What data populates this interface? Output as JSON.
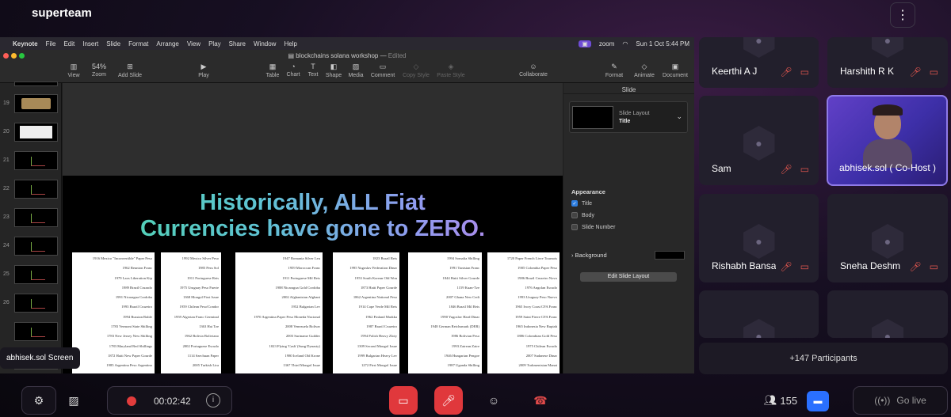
{
  "app": {
    "brand": "superteam",
    "menu_icon": "kebab-icon"
  },
  "mac_menubar": {
    "app_name": "Keynote",
    "items": [
      "File",
      "Edit",
      "Insert",
      "Slide",
      "Format",
      "Arrange",
      "View",
      "Play",
      "Share",
      "Window",
      "Help"
    ],
    "zoom": "zoom",
    "datetime": "Sun 1 Oct  5:44 PM"
  },
  "keynote": {
    "doc_title": "blockchains solana workshop",
    "doc_status": "Edited",
    "zoom_level": "54%",
    "toolbar": {
      "view": "View",
      "zoom": "Zoom",
      "add_slide": "Add Slide",
      "play": "Play",
      "table": "Table",
      "chart": "Chart",
      "text": "Text",
      "shape": "Shape",
      "media": "Media",
      "comment": "Comment",
      "copy_style": "Copy Style",
      "paste_style": "Paste Style",
      "collaborate": "Collaborate",
      "format": "Format",
      "animate": "Animate",
      "document": "Document"
    },
    "navigator": [
      "19",
      "20",
      "21",
      "22",
      "23",
      "24",
      "25",
      "26"
    ],
    "slide": {
      "heading_line1": "Historically, ALL Fiat",
      "heading_line2": "Currencies have gone to ZERO.",
      "columns": [
        [
          "1916 Mexico \"Inconvertible\" Paper Peso",
          "1962 Reunion Franc",
          "1979 Laos Liberation Kip",
          "1989 Brazil Cruzado",
          "1991 Nicaragua Cordoba",
          "1993 Brazil Cruzeiro",
          "1994 Russian Ruble",
          "1783 Vermont State Shilling",
          "1783 New Jersey New Shilling",
          "1783 Maryland Red Shillings",
          "1872 Haiti New Paper Gourde",
          "1985 Argentina Peso Argentino",
          "1991 Yugoslav Convertible Dinar"
        ],
        [
          "1992 Mexico Silver Peso",
          "1985 Peru Sol",
          "1911 Portuguese Reis",
          "1975 Uruguay Peso Fuerte",
          "1368 Mongol First Issue",
          "1959 Chilean Peso/Condor",
          "1959 Algerian Franc Germinal",
          "1363 Hai Tze",
          "1962 Bolivia Boliviano",
          "2002 Portuguese Escudo",
          "1114 Szechuan Paper",
          "2005 Turkish Lira",
          "1450 Great Ming Precious Notes"
        ],
        [
          "1947 Romania Silver Leu",
          "1959 Moroccan Franc",
          "1911 Portuguese Mil Reis",
          "1988 Nicaragua Gold Cordoba",
          "2002 Afghanistan Afghani",
          "1952 Bulgarian Lev",
          "1970 Argentina Paper Peso Moneda Nacional",
          "2008 Venezuela Bolivar",
          "2003 Suriname Guilder",
          "1023 Flying 'Cash' (Sung Dynasty)",
          "1980 Iceland Old Krone",
          "1367 Third Mongol Issue",
          "1924 German Mark"
        ],
        [
          "1823 Brazil Reis",
          "1995 Yugoslav Federation Dinar",
          "1953 South Korean Old Won",
          "1873 Haiti Paper Gourde",
          "1862 Argentina National Peso",
          "1914 Cape Verde Mil Reis",
          "1962 Finland Markka",
          "1987 Brazil Cruzeiro",
          "1994 Polish Heavy Zloty",
          "1309 Second Mongol Issue",
          "1999 Bulgarian Heavy Lev",
          "1272 First Mongol Issue",
          "1911 Mozambique Mil Reis"
        ],
        [
          "1994 Somalia Shilling",
          "1991 Tunisian Franc",
          "1844 Haiti Silver Gourde",
          "1159 Kuan-Tze",
          "2007 Ghana New Cedi",
          "1846 Brazil Mil Reis",
          "1990 Yugoslav Hard Dinar",
          "1948 German Reichsmark (DER)",
          "1986 Bolivian Peso",
          "1993 Zairean Zaire",
          "1946 Hungarian Pengoe",
          "1987 Uganda Shilling",
          "1975 South Viet Nam Republic Dong"
        ],
        [
          "1720 Paper French Livre Tournois",
          "1905 Colombia Paper Peso",
          "1986 Brazil Cruzeiro Novo",
          "1976 Angolan Escudo",
          "1993 Uruguay Peso Nuevo",
          "1965 Ivory Coast CFA Franc",
          "1959 Saint Pierre CFA Franc",
          "1965 Indonesia New Rupiah",
          "1886 Colombian Gold Peso",
          "1975 Chilean Escudo",
          "2007 Sudanese Dinar",
          "2009 Turkmenistan Manat",
          "1991 Angola Kwanza"
        ]
      ]
    },
    "inspector": {
      "tab": "Slide",
      "layout_label": "Slide Layout",
      "layout_value": "Title",
      "appearance_label": "Appearance",
      "checks": [
        {
          "label": "Title",
          "checked": true
        },
        {
          "label": "Body",
          "checked": false
        },
        {
          "label": "Slide Number",
          "checked": false
        }
      ],
      "background_label": "Background",
      "edit_button": "Edit Slide Layout"
    }
  },
  "screen_share_label": "abhisek.sol Screen",
  "participants": [
    {
      "name": "Keerthi A J",
      "mic": "muted",
      "cam": "off"
    },
    {
      "name": "Harshith R K",
      "mic": "muted",
      "cam": "off"
    },
    {
      "name": "Sam",
      "mic": "muted",
      "cam": "off"
    },
    {
      "name": "abhisek.sol ( Co-Host )",
      "mic": "on",
      "cam": "on"
    },
    {
      "name": "Rishabh Bansa",
      "mic": "muted",
      "cam": "off"
    },
    {
      "name": "Sneha Deshm",
      "mic": "muted",
      "cam": "off"
    }
  ],
  "more_participants": "+147 Participants",
  "controls": {
    "timer": "00:02:42",
    "participant_count": "155",
    "go_live": "Go live"
  },
  "colors": {
    "accent": "#8f7ae8",
    "danger": "#e0383c",
    "chat": "#2a70ff"
  }
}
